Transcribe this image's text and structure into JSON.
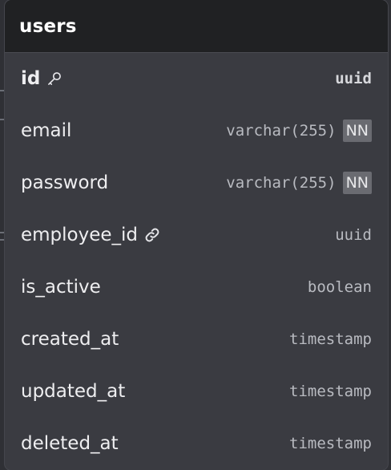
{
  "table": {
    "name": "users",
    "columns": [
      {
        "name": "id",
        "type": "uuid",
        "primary_key": true,
        "icon": "key-icon",
        "not_null": false
      },
      {
        "name": "email",
        "type": "varchar(255)",
        "not_null": true,
        "badge": "NN"
      },
      {
        "name": "password",
        "type": "varchar(255)",
        "not_null": true,
        "badge": "NN"
      },
      {
        "name": "employee_id",
        "type": "uuid",
        "foreign_key": true,
        "icon": "link-icon"
      },
      {
        "name": "is_active",
        "type": "boolean"
      },
      {
        "name": "created_at",
        "type": "timestamp"
      },
      {
        "name": "updated_at",
        "type": "timestamp"
      },
      {
        "name": "deleted_at",
        "type": "timestamp"
      }
    ]
  },
  "colors": {
    "background": "#2f3035",
    "card": "#3a3b41",
    "header": "#202123",
    "badge": "#6a6b71"
  }
}
